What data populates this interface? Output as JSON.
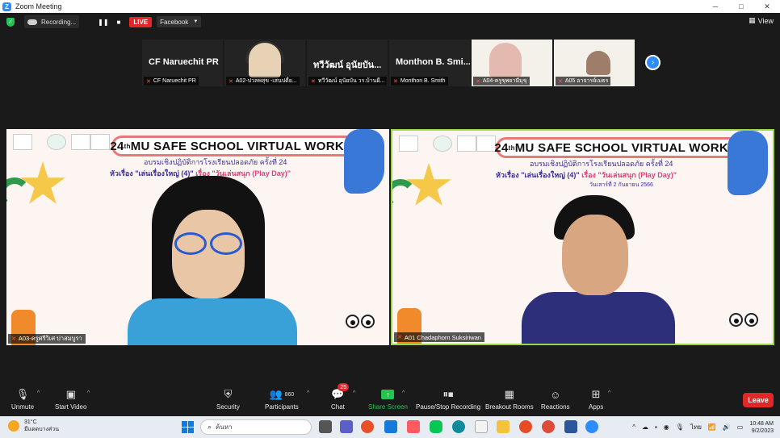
{
  "window": {
    "title": "Zoom Meeting",
    "logo": "Z",
    "controls": [
      "─",
      "□",
      "✕"
    ]
  },
  "status": {
    "recording_label": "Recording...",
    "pause_icon": "❚❚",
    "stop_icon": "■",
    "live_label": "LIVE",
    "stream_target": "Facebook",
    "view_label": "View"
  },
  "thumbnails": [
    {
      "name_overlay": "CF Naruechit PR",
      "label": "CF Naruechit PR"
    },
    {
      "name_overlay": "",
      "label": "A02-ปวลพสุข -เสนปดื่ย..."
    },
    {
      "name_overlay": "ทวีวัฒน์ อุนัยบัน...",
      "label": "ทวีวัฒน์ อุนัยบัน วร.บ้านผื..."
    },
    {
      "name_overlay": "Monthon B. Smi...",
      "label": "Monthon B. Smith"
    },
    {
      "name_overlay": "",
      "label": "A04-ครูขุพยามีมุขุ"
    },
    {
      "name_overlay": "",
      "label": "A05 อาจารย์เมธร"
    }
  ],
  "slide": {
    "title_num": "24",
    "title_sup": "th",
    "title_rest": " MU SAFE SCHOOL VIRTUAL WORKSHOP",
    "thai_line1": "อบรมเชิงปฏิบัติการโรงเรียนปลอดภัย ครั้งที่ 24",
    "thai_line2_prefix": "หัวเรื่อง ",
    "thai_line2_topic": "\"เล่นเรื่องใหญ่ (4)\"",
    "thai_line2_sub": " เรื่อง \"วันเล่นสนุก (Play Day)\"",
    "thai_line3": "วันเสาร์ที่ 2 กันยายน 2566"
  },
  "panels": {
    "left_label": "A03-ครูศรีวิเศ บ่าสมบูรา",
    "right_label": "A01 Chadaphorn Suksiriwan"
  },
  "toolbar": {
    "unmute": "Unmute",
    "start_video": "Start Video",
    "security": "Security",
    "participants": "Participants",
    "participant_count": "860",
    "chat": "Chat",
    "chat_badge": "25",
    "share_screen": "Share Screen",
    "pause_stop_recording": "Pause/Stop Recording",
    "breakout_rooms": "Breakout Rooms",
    "reactions": "Reactions",
    "apps": "Apps",
    "leave": "Leave"
  },
  "taskbar": {
    "temperature": "31°C",
    "weather_desc": "มีแดดบางส่วน",
    "search_placeholder": "ค้นหา",
    "language": "ไทย",
    "time": "10:48 AM",
    "date": "9/2/2023"
  },
  "colors": {
    "zoom_blue": "#2d8cff",
    "live_red": "#e02828",
    "share_green": "#23c552",
    "active_speaker": "#9bd64a"
  }
}
